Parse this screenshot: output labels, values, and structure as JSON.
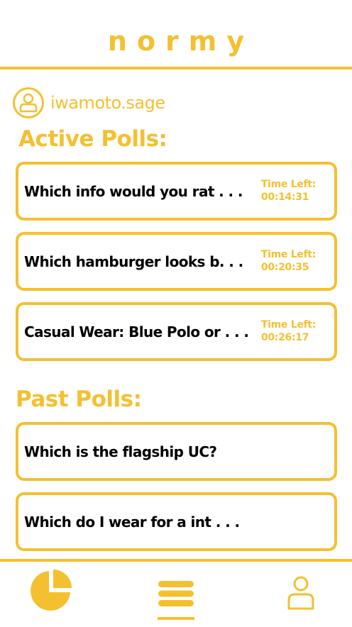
{
  "app": {
    "title": "normy"
  },
  "user": {
    "username": "iwamoto.sage"
  },
  "sections": {
    "active_title": "Active Polls:",
    "past_title": "Past Polls:"
  },
  "active_polls": [
    {
      "question": "Which info would you rat . . .",
      "time_label": "Time Left:",
      "time_left": "00:14:31"
    },
    {
      "question": "Which hamburger looks b. . .",
      "time_label": "Time Left:",
      "time_left": "00:20:35"
    },
    {
      "question": "Casual Wear: Blue Polo or . . .",
      "time_label": "Time Left:",
      "time_left": "00:26:17"
    }
  ],
  "past_polls": [
    {
      "question": "Which is the flagship UC?"
    },
    {
      "question": "Which do I wear for a int . . ."
    }
  ],
  "nav": {
    "items": [
      {
        "icon": "pie-chart-icon",
        "active": false
      },
      {
        "icon": "list-menu-icon",
        "active": true
      },
      {
        "icon": "profile-icon",
        "active": false
      }
    ]
  },
  "colors": {
    "accent": "#F4C030",
    "text": "#000000",
    "background": "#FFFFFF"
  }
}
